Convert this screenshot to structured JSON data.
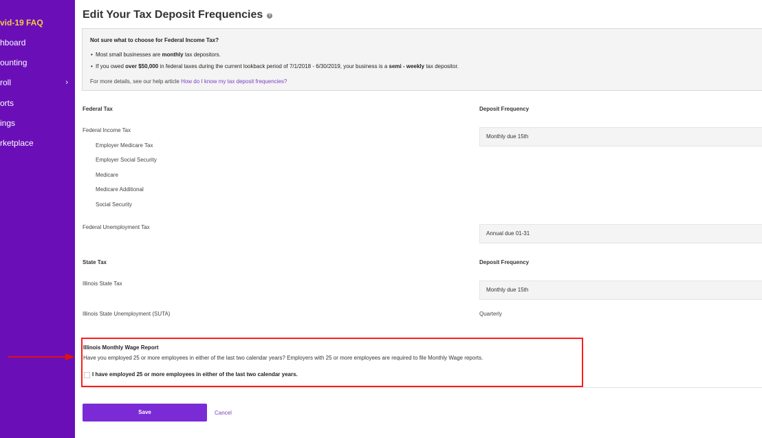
{
  "sidebar": {
    "items": [
      {
        "label": "vid-19 FAQ"
      },
      {
        "label": "hboard"
      },
      {
        "label": "ounting"
      },
      {
        "label": "roll"
      },
      {
        "label": "orts"
      },
      {
        "label": "ings"
      },
      {
        "label": "rketplace"
      }
    ],
    "chevron": "›"
  },
  "page": {
    "title": "Edit Your Tax Deposit Frequencies",
    "help_icon": "?"
  },
  "info": {
    "question": "Not sure what to choose for Federal Income Tax?",
    "bullet1_pre": "Most small businesses are ",
    "bullet1_bold": "monthly",
    "bullet1_post": " tax depositors.",
    "bullet2_pre": "If you owed ",
    "bullet2_bold1": "over $50,000",
    "bullet2_mid": " in federal taxes during the current lookback period of 7/1/2018 - 6/30/2019, your business is a ",
    "bullet2_bold2": "semi - weekly",
    "bullet2_post": " tax depositor.",
    "more_text": "For more details, see our help article ",
    "more_link": "How do I know my tax deposit frequencies?"
  },
  "federal": {
    "header": "Federal Tax",
    "freq_header": "Deposit Frequency",
    "income_tax": "Federal Income Tax",
    "income_freq": "Monthly due 15th",
    "sub_items": [
      "Employer Medicare Tax",
      "Employer Social Security",
      "Medicare",
      "Medicare Additional",
      "Social Security"
    ],
    "unemployment": "Federal Unemployment Tax",
    "unemployment_freq": "Annual due 01-31"
  },
  "state": {
    "header": "State Tax",
    "freq_header": "Deposit Frequency",
    "state_tax": "Illinois State Tax",
    "state_tax_freq": "Monthly due 15th",
    "suta": "Illinois State Unemployment (SUTA)",
    "suta_freq": "Quarterly"
  },
  "wage_report": {
    "title": "Illinois Monthly Wage Report",
    "question": "Have you employed 25 or more employees in either of the last two calendar years? Employers with 25 or more employees are required to file Monthly Wage reports.",
    "checkbox_label": "I have employed 25 or more employees in either of the last two calendar years.",
    "checked": false
  },
  "actions": {
    "save": "Save",
    "cancel": "Cancel"
  },
  "colors": {
    "sidebar": "#6a0fb8",
    "accent": "#7b2bd6",
    "faq": "#f7c948",
    "highlight": "#ff1a1a"
  }
}
